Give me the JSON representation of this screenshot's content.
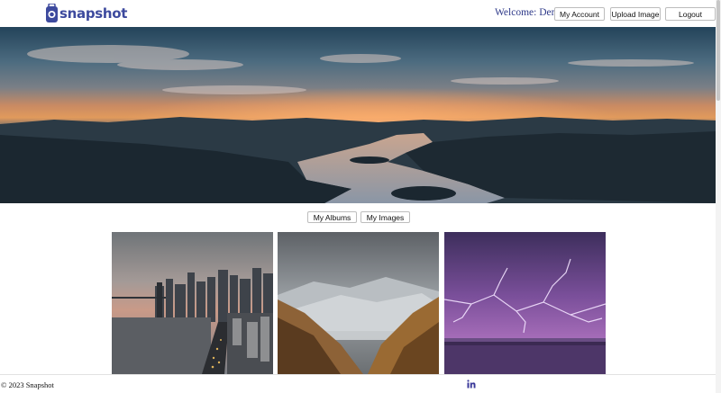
{
  "header": {
    "logo_text": "snapshot",
    "welcome": "Welcome: Demo",
    "buttons": {
      "account": "My Account",
      "upload": "Upload Image",
      "logout": "Logout"
    }
  },
  "tabs": {
    "albums": "My Albums",
    "images": "My Images"
  },
  "gallery": [
    {
      "icon": "city-bridge-sunset-photo"
    },
    {
      "icon": "mountain-valley-fog-photo"
    },
    {
      "icon": "lightning-storm-lake-photo"
    }
  ],
  "footer": {
    "copyright": "© 2023 Snapshot",
    "social_icon": "linkedin-icon"
  },
  "colors": {
    "brand": "#3d4a9e",
    "linkedin": "#3b3a9a"
  }
}
